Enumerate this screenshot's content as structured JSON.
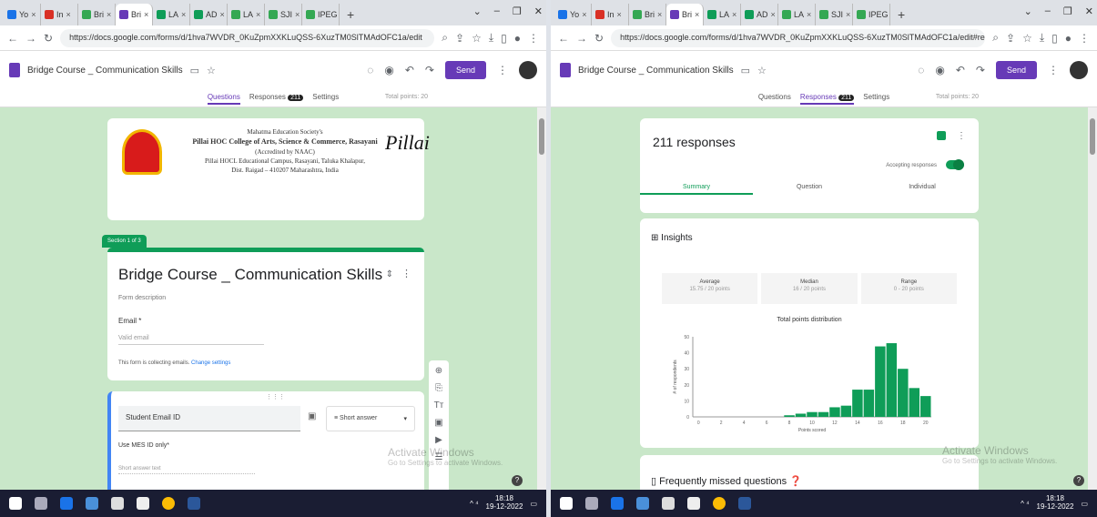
{
  "left": {
    "tabs": [
      {
        "label": "Yo",
        "color": "#1a73e8"
      },
      {
        "label": "In",
        "color": "#d93025"
      },
      {
        "label": "Bri",
        "color": "#34a853"
      },
      {
        "label": "Bri",
        "color": "#673ab7",
        "active": true
      },
      {
        "label": "LA",
        "color": "#0f9d58"
      },
      {
        "label": "AD",
        "color": "#0f9d58"
      },
      {
        "label": "LA",
        "color": "#34a853"
      },
      {
        "label": "SJI",
        "color": "#34a853"
      },
      {
        "label": "IPEG",
        "color": "#34a853"
      }
    ],
    "url": "https://docs.google.com/forms/d/1hva7WVDR_0KuZpmXXKLuQSS-6XuzTM0SlTMAdOFC1a/edit",
    "form_title": "Bridge Course _ Communication Skills",
    "nav": {
      "questions": "Questions",
      "responses": "Responses",
      "count": "211",
      "settings": "Settings"
    },
    "total_points": "Total points: 20",
    "send": "Send",
    "college": {
      "line1": "Mahatma Education Society's",
      "line2": "Pillai HOC College of Arts, Science & Commerce, Rasayani",
      "line3": "(Accredited by NAAC)",
      "line4": "Pillai HOCL Educational Campus, Rasayani, Taluka Khalapur,",
      "line5": "Dist. Raigad – 410207 Maharashtra, India",
      "signature": "Pillai"
    },
    "section": "Section 1 of 3",
    "title": "Bridge Course _ Communication Skills",
    "description": "Form description",
    "email_label": "Email *",
    "email_placeholder": "Valid email",
    "collecting": "This form is collecting emails.",
    "change_settings": "Change settings",
    "question": {
      "title": "Student Email ID",
      "type": "Short answer",
      "hint": "Use MES ID only*",
      "short": "Short answer text"
    },
    "watermark": {
      "line1": "Activate Windows",
      "line2": "Go to Settings to activate Windows."
    },
    "clock": {
      "time": "18:18",
      "date": "19-12-2022"
    }
  },
  "right": {
    "tabs": [
      {
        "label": "Yo",
        "color": "#1a73e8"
      },
      {
        "label": "In",
        "color": "#d93025"
      },
      {
        "label": "Bri",
        "color": "#34a853"
      },
      {
        "label": "Bri",
        "color": "#673ab7",
        "active": true
      },
      {
        "label": "LA",
        "color": "#0f9d58"
      },
      {
        "label": "AD",
        "color": "#0f9d58"
      },
      {
        "label": "LA",
        "color": "#34a853"
      },
      {
        "label": "SJI",
        "color": "#34a853"
      },
      {
        "label": "IPEG",
        "color": "#34a853"
      }
    ],
    "url": "https://docs.google.com/forms/d/1hva7WVDR_0KuZpmXXKLuQSS-6XuzTM0SlTMAdOFC1a/edit#resp...",
    "form_title": "Bridge Course _ Communication Skills",
    "nav": {
      "questions": "Questions",
      "responses": "Responses",
      "count": "211",
      "settings": "Settings"
    },
    "total_points": "Total points: 20",
    "send": "Send",
    "responses_title": "211 responses",
    "accepting": "Accepting responses",
    "subtabs": {
      "summary": "Summary",
      "question": "Question",
      "individual": "Individual"
    },
    "insights": "Insights",
    "stats": [
      {
        "label": "Average",
        "value": "15.75 / 20 points"
      },
      {
        "label": "Median",
        "value": "16 / 20 points"
      },
      {
        "label": "Range",
        "value": "0 - 20 points"
      }
    ],
    "chart_caption": "Total points distribution",
    "missed": "Frequently missed questions",
    "watermark": {
      "line1": "Activate Windows",
      "line2": "Go to Settings to activate Windows."
    },
    "clock": {
      "time": "18:18",
      "date": "19-12-2022"
    }
  },
  "chart_data": {
    "type": "bar",
    "title": "Total points distribution",
    "xlabel": "Points scored",
    "ylabel": "# of respondents",
    "x": [
      0,
      1,
      2,
      3,
      4,
      5,
      6,
      7,
      8,
      9,
      10,
      11,
      12,
      13,
      14,
      15,
      16,
      17,
      18,
      19,
      20
    ],
    "values": [
      0,
      0,
      0,
      0,
      0,
      0,
      0,
      0,
      1,
      2,
      3,
      3,
      6,
      7,
      17,
      17,
      44,
      46,
      30,
      18,
      13
    ],
    "xticks": [
      0,
      2,
      4,
      6,
      8,
      10,
      12,
      14,
      16,
      18,
      20
    ],
    "yticks": [
      0,
      10,
      20,
      30,
      40,
      50
    ],
    "ylim": [
      0,
      50
    ],
    "color": "#0f9d58"
  }
}
